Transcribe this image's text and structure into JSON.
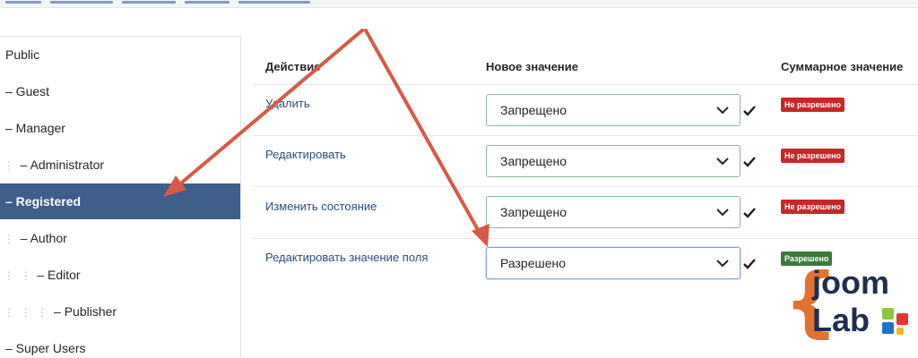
{
  "sidebar": {
    "items": [
      {
        "label": "Public",
        "depth": 0,
        "selected": false
      },
      {
        "label": "– Guest",
        "depth": 0,
        "selected": false
      },
      {
        "label": "– Manager",
        "depth": 0,
        "selected": false
      },
      {
        "label": "– Administrator",
        "depth": 1,
        "selected": false
      },
      {
        "label": "– Registered",
        "depth": 0,
        "selected": true
      },
      {
        "label": "– Author",
        "depth": 1,
        "selected": false
      },
      {
        "label": "– Editor",
        "depth": 2,
        "selected": false
      },
      {
        "label": "– Publisher",
        "depth": 3,
        "selected": false
      },
      {
        "label": "– Super Users",
        "depth": 0,
        "selected": false
      }
    ]
  },
  "table": {
    "headers": {
      "action": "Действие",
      "new_value": "Новое значение",
      "calculated": "Суммарное значение"
    },
    "rows": [
      {
        "action": "Удалить",
        "value": "Запрещено",
        "calculated": "Не разрешено",
        "status": "denied"
      },
      {
        "action": "Редактировать",
        "value": "Запрещено",
        "calculated": "Не разрешено",
        "status": "denied"
      },
      {
        "action": "Изменить состояние",
        "value": "Запрещено",
        "calculated": "Не разрешено",
        "status": "denied"
      },
      {
        "action": "Редактировать значение поля",
        "value": "Разрешено",
        "calculated": "Разрешено",
        "status": "allowed"
      }
    ]
  },
  "icons": {
    "select_arrow": "chevron-down-icon",
    "saved_mark": "check-icon"
  },
  "colors": {
    "selected_bg": "#3e5f8a",
    "denied": "#c52827",
    "allowed": "#3c7a3c",
    "arrow": "#d65a46",
    "logo_orange": "#e2722f",
    "logo_navy": "#1f2e4f"
  },
  "logo": {
    "line1": "joom",
    "line2": "Lab"
  }
}
